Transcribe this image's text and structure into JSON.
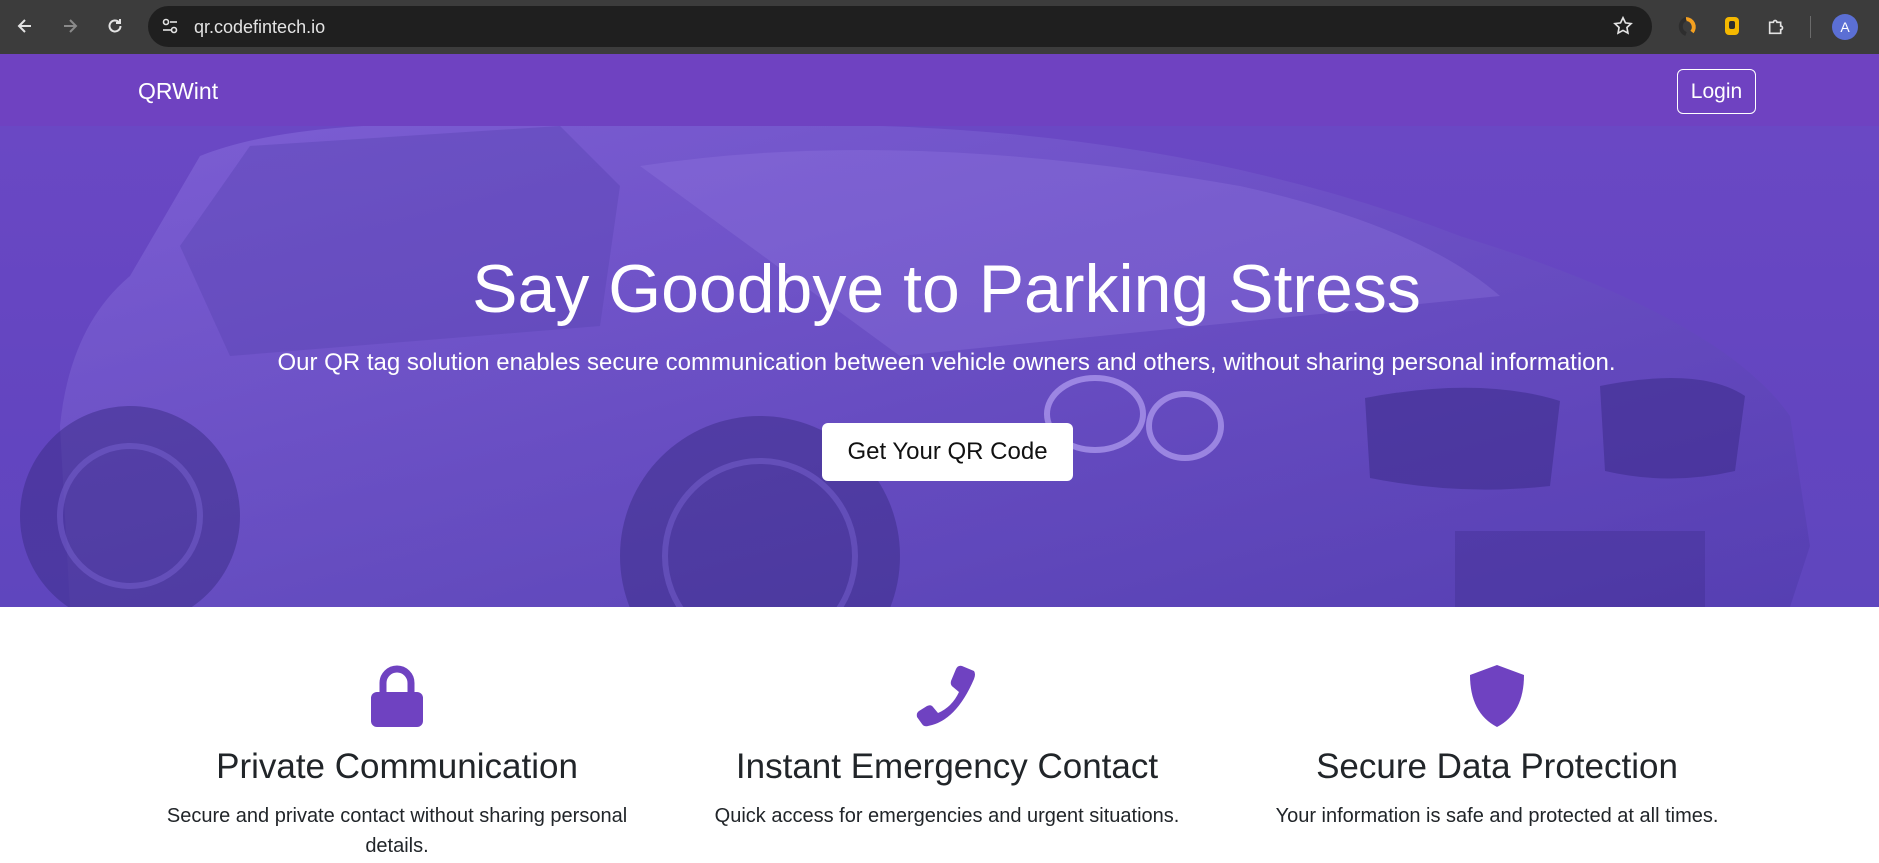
{
  "browser": {
    "url": "qr.codefintech.io",
    "profile_initial": "A",
    "icons": [
      "back-arrow-icon",
      "forward-arrow-icon",
      "reload-icon",
      "site-settings-icon",
      "bookmark-star-icon",
      "extension-icon",
      "puzzle-icon"
    ]
  },
  "navbar": {
    "brand": "QRWint",
    "login_label": "Login"
  },
  "hero": {
    "title": "Say Goodbye to Parking Stress",
    "subtitle": "Our QR tag solution enables secure communication between vehicle owners and others, without sharing personal information.",
    "cta_label": "Get Your QR Code"
  },
  "features": [
    {
      "icon": "lock-icon",
      "title": "Private Communication",
      "description": "Secure and private contact without sharing personal details."
    },
    {
      "icon": "phone-icon",
      "title": "Instant Emergency Contact",
      "description": "Quick access for emergencies and urgent situations."
    },
    {
      "icon": "shield-icon",
      "title": "Secure Data Protection",
      "description": "Your information is safe and protected at all times."
    }
  ],
  "colors": {
    "brand_purple": "#6f42c1",
    "hero_overlay": "#6345c0",
    "text_dark": "#212529"
  }
}
